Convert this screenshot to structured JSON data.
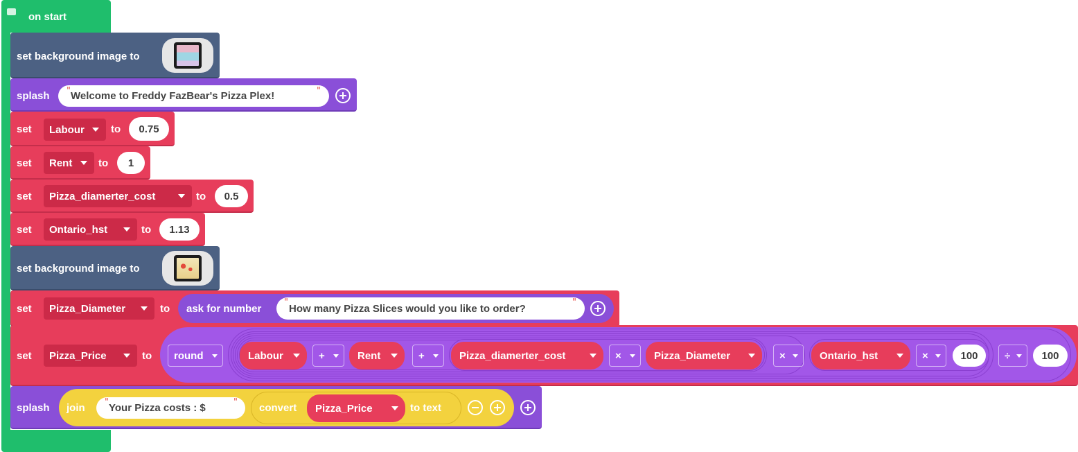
{
  "colors": {
    "events": "#1fbe6c",
    "scene": "#4c6183",
    "game": "#8a4fd8",
    "variables": "#e73d5b",
    "variables_dark": "#cc2a48",
    "text": "#f3d23e",
    "text_dark": "#e6be21",
    "math": "#a257e8"
  },
  "hat": {
    "label": "on start",
    "icon": "comment-icon"
  },
  "row_bg1": {
    "label": "set background image to"
  },
  "row_splash1": {
    "label": "splash",
    "text": "Welcome to Freddy FazBear's Pizza Plex!"
  },
  "row_labour": {
    "set": "set",
    "var": "Labour",
    "to": "to",
    "value": "0.75"
  },
  "row_rent": {
    "set": "set",
    "var": "Rent",
    "to": "to",
    "value": "1"
  },
  "row_pdc": {
    "set": "set",
    "var": "Pizza_diamerter_cost",
    "to": "to",
    "value": "0.5"
  },
  "row_hst": {
    "set": "set",
    "var": "Ontario_hst",
    "to": "to",
    "value": "1.13"
  },
  "row_bg2": {
    "label": "set background image to"
  },
  "row_pd": {
    "set": "set",
    "var": "Pizza_Diameter",
    "to": "to",
    "ask": "ask for number",
    "question": "How many Pizza Slices would you like to order?"
  },
  "row_pp": {
    "set": "set",
    "var": "Pizza_Price",
    "to": "to",
    "round": "round",
    "v_labour": "Labour",
    "op1": "+",
    "v_rent": "Rent",
    "op2": "+",
    "v_pdc": "Pizza_diamerter_cost",
    "op3": "×",
    "v_pd": "Pizza_Diameter",
    "op4": "×",
    "v_hst": "Ontario_hst",
    "op5": "×",
    "n100a": "100",
    "op6": "÷",
    "n100b": "100"
  },
  "row_splash2": {
    "label": "splash",
    "join": "join",
    "text": "Your Pizza costs : $",
    "convert": "convert",
    "var": "Pizza_Price",
    "to_text": "to text"
  }
}
